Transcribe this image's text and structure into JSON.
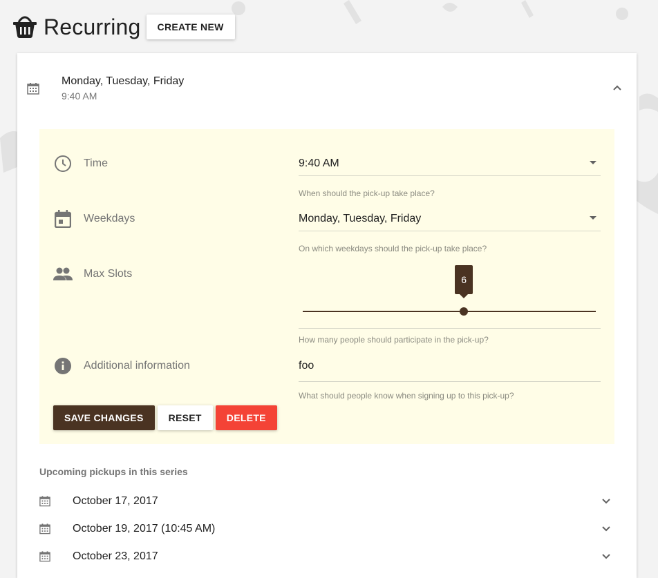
{
  "header": {
    "title": "Recurring",
    "create_button": "CREATE NEW"
  },
  "series": {
    "weekdays": "Monday, Tuesday, Friday",
    "time": "9:40 AM",
    "expanded": true
  },
  "form": {
    "time": {
      "label": "Time",
      "value": "9:40 AM",
      "hint": "When should the pick-up take place?"
    },
    "weekdays": {
      "label": "Weekdays",
      "value": "Monday, Tuesday, Friday",
      "hint": "On which weekdays should the pick-up take place?"
    },
    "max_slots": {
      "label": "Max Slots",
      "value": "6",
      "fraction": 0.55,
      "hint": "How many people should participate in the pick-up?"
    },
    "additional_info": {
      "label": "Additional information",
      "value": "foo",
      "hint": "What should people know when signing up to this pick-up?"
    }
  },
  "actions": {
    "save": "SAVE CHANGES",
    "reset": "RESET",
    "delete": "DELETE"
  },
  "upcoming": {
    "title": "Upcoming pickups in this series",
    "items": [
      {
        "date": "October 17, 2017"
      },
      {
        "date": "October 19, 2017 (10:45 AM)"
      },
      {
        "date": "October 23, 2017"
      }
    ]
  },
  "colors": {
    "primary": "#4a3322",
    "danger": "#f44336",
    "panel_bg": "#fffde7"
  },
  "icons": {
    "logo": "basket-icon",
    "series": "calendar-icon",
    "collapse": "chevron-up-icon",
    "time": "clock-icon",
    "weekdays": "event-icon",
    "max_slots": "people-icon",
    "info": "info-icon",
    "expand": "chevron-down-icon"
  }
}
